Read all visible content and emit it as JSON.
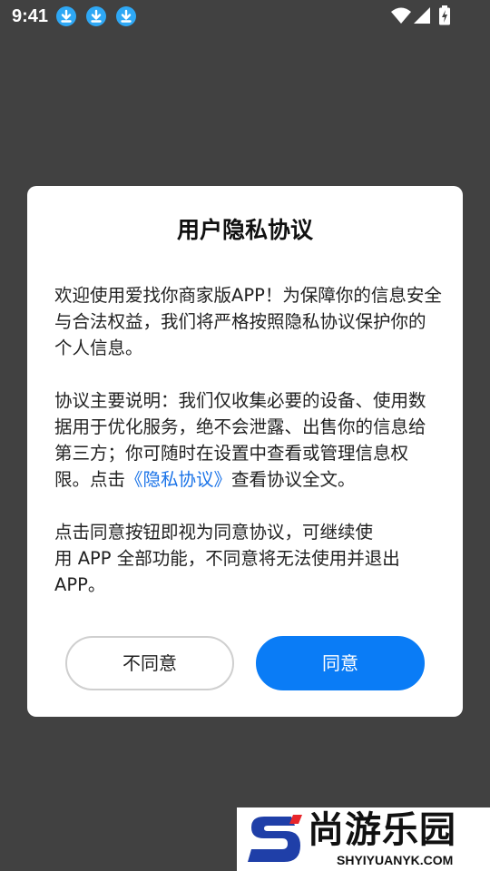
{
  "status_bar": {
    "time": "9:41",
    "notification_icons": [
      "download-icon",
      "download-icon",
      "download-icon"
    ],
    "right_icons": [
      "wifi-icon",
      "cellular-signal-icon",
      "battery-charging-icon"
    ]
  },
  "dialog": {
    "title": "用户隐私协议",
    "paragraph1": "欢迎使用爱找你商家版APP！为保障你的信息安全与合法权益，我们将严格按照隐私协议保护你的个人信息。",
    "paragraph2_before_link": "协议主要说明：我们仅收集必要的设备、使用数据用于优化服务，绝不会泄露、出售你的信息给第三方；你可随时在设置中查看或管理信息权限。点击",
    "policy_link": "《隐私协议》",
    "paragraph2_after_link": "查看协议全文。",
    "paragraph3_line1": "点击同意按钮即视为同意协议，可继续使",
    "paragraph3_line2": "用 APP 全部功能，不同意将无法使用并退出",
    "paragraph3_line3": "APP。",
    "decline_label": "不同意",
    "agree_label": "同意"
  },
  "watermark": {
    "name": "尚游乐园",
    "domain": "SHYIYUANYK.COM"
  },
  "colors": {
    "backdrop": "#414141",
    "accent": "#0a7cf6",
    "link": "#1a73e8",
    "notification_icon": "#2ea8f5",
    "watermark_blue": "#1f3fa8",
    "watermark_red": "#e8262b"
  }
}
